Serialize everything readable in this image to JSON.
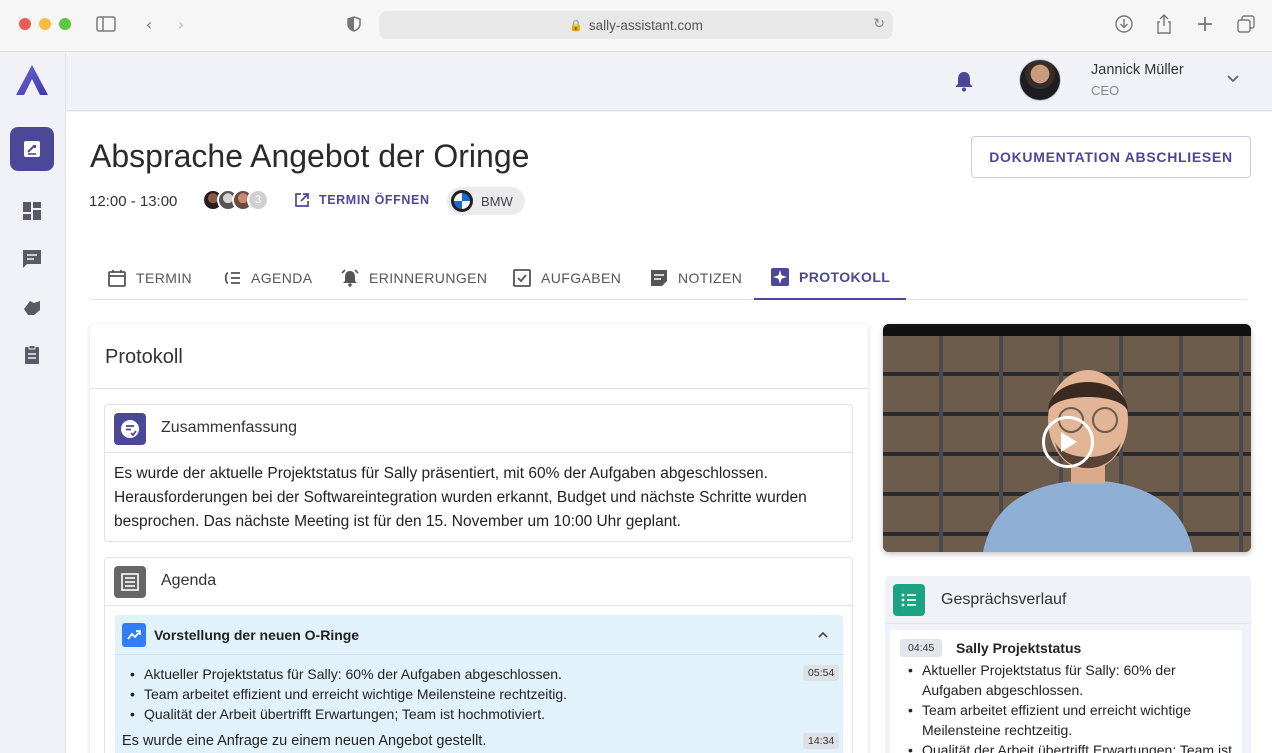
{
  "browser": {
    "url": "sally-assistant.com"
  },
  "header": {
    "user_name": "Jannick Müller",
    "user_role": "CEO"
  },
  "meeting": {
    "title": "Absprache Angebot der Oringe",
    "time": "12:00 - 13:00",
    "participants_more": "3",
    "open_link": "TERMIN ÖFFNEN",
    "company": "BMW",
    "doc_button": "DOKUMENTATION ABSCHLIESEN"
  },
  "tabs": [
    {
      "label": "TERMIN",
      "icon": "calendar-icon"
    },
    {
      "label": "AGENDA",
      "icon": "agenda-list-icon"
    },
    {
      "label": "ERINNERUNGEN",
      "icon": "alarm-icon"
    },
    {
      "label": "AUFGABEN",
      "icon": "checkbox-icon"
    },
    {
      "label": "NOTIZEN",
      "icon": "notes-icon"
    },
    {
      "label": "PROTOKOLL",
      "icon": "sparkle-icon",
      "active": true
    }
  ],
  "protokoll": {
    "title": "Protokoll",
    "summary": {
      "title": "Zusammenfassung",
      "text": "Es wurde der aktuelle Projektstatus für Sally präsentiert, mit 60% der Aufgaben abgeschlossen. Herausforderungen bei der Softwareintegration wurden erkannt, Budget und nächste Schritte wurden besprochen. Das nächste Meeting ist für den 15. November um 10:00 Uhr geplant."
    },
    "agenda": {
      "title": "Agenda",
      "item": {
        "title": "Vorstellung der neuen O-Ringe",
        "bullets": [
          "Aktueller Projektstatus für Sally: 60% der Aufgaben abgeschlossen.",
          "Team arbeitet effizient und erreicht wichtige Meilensteine rechtzeitig.",
          "Qualität der Arbeit übertrifft Erwartungen; Team ist hochmotiviert."
        ],
        "timestamp1": "05:54",
        "request": "Es wurde eine Anfrage zu einem neuen Angebot gestellt.",
        "timestamp2": "14:34"
      }
    }
  },
  "verlauf": {
    "title": "Gesprächsverlauf",
    "entry": {
      "timestamp": "04:45",
      "title": "Sally Projektstatus",
      "bullets": [
        "Aktueller Projektstatus für Sally: 60% der Aufgaben abgeschlossen.",
        "Team arbeitet effizient und erreicht wichtige Meilensteine rechtzeitig.",
        "Qualität der Arbeit übertrifft Erwartungen; Team ist hochmotiviert."
      ]
    }
  },
  "colors": {
    "accent": "#4c4898",
    "agenda_item_bg": "#e1f2fb",
    "verlauf_icon": "#1ba384"
  }
}
